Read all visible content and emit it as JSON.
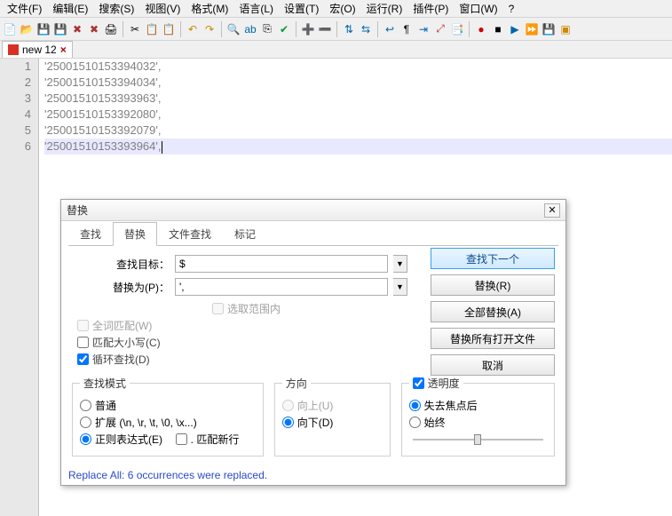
{
  "menu": {
    "file": "文件(F)",
    "edit": "编辑(E)",
    "search": "搜索(S)",
    "view": "视图(V)",
    "format": "格式(M)",
    "language": "语言(L)",
    "settings": "设置(T)",
    "macro": "宏(O)",
    "run": "运行(R)",
    "plugins": "插件(P)",
    "window": "窗口(W)",
    "help": "?"
  },
  "tab": {
    "name": "new 12",
    "close": "×"
  },
  "code": {
    "linenums": [
      "1",
      "2",
      "3",
      "4",
      "5",
      "6"
    ],
    "lines": [
      "'25001510153394032',",
      "'25001510153394034',",
      "'25001510153393963',",
      "'25001510153392080',",
      "'25001510153392079',",
      "'25001510153393964',"
    ]
  },
  "dialog": {
    "title": "替换",
    "tabs": {
      "find": "查找",
      "replace": "替换",
      "findfiles": "文件查找",
      "mark": "标记"
    },
    "lbl_find": "查找目标：",
    "lbl_replace": "替换为(P)：",
    "val_find": "$",
    "val_replace": "',",
    "chk_range": "选取范围内",
    "chk_wholeword": "全词匹配(W)",
    "chk_matchcase": "匹配大小写(C)",
    "chk_wrap": "循环查找(D)",
    "grp_mode": "查找模式",
    "mode_normal": "普通",
    "mode_ext": "扩展 (\\n, \\r, \\t, \\0, \\x...)",
    "mode_regex": "正则表达式(E)",
    "mode_dotnl": ". 匹配新行",
    "grp_dir": "方向",
    "dir_up": "向上(U)",
    "dir_down": "向下(D)",
    "grp_trans": "透明度",
    "trans_onlose": "失去焦点后",
    "trans_always": "始终",
    "btn_findnext": "查找下一个",
    "btn_replace": "替换(R)",
    "btn_replaceall": "全部替换(A)",
    "btn_replaceallopen": "替换所有打开文件",
    "btn_cancel": "取消",
    "status": "Replace All: 6 occurrences were replaced."
  }
}
